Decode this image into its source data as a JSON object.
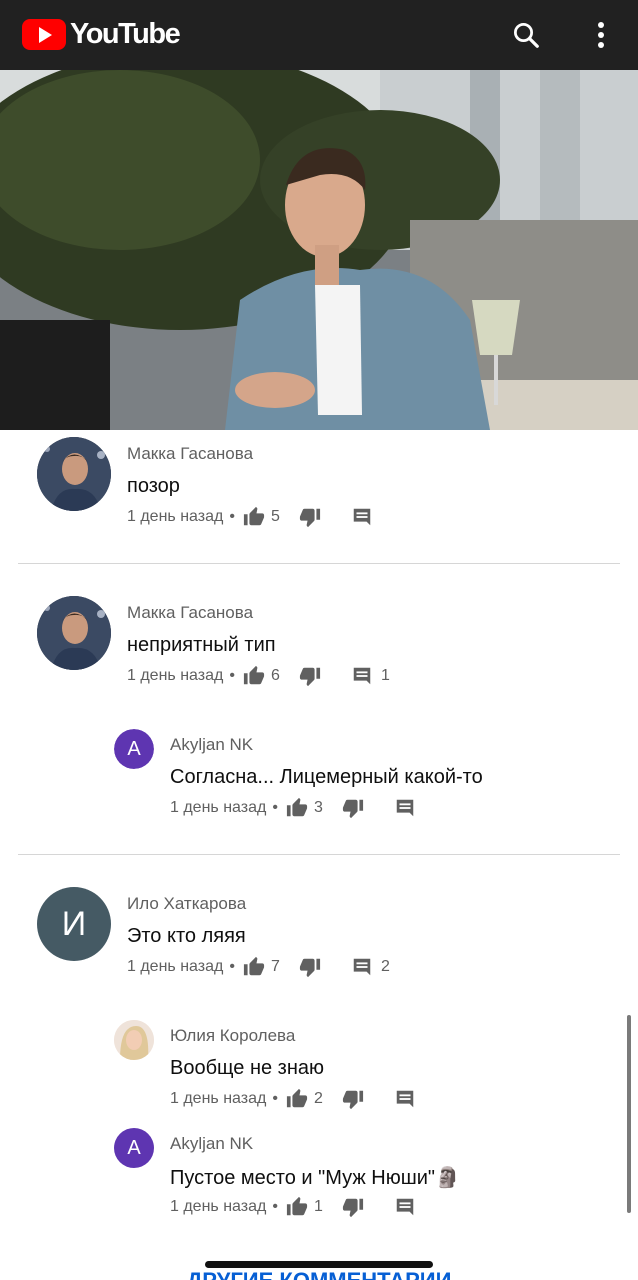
{
  "app": {
    "logo_text": "YouTube",
    "brand_color": "#ff0000",
    "header_bg": "#212121",
    "icons": [
      "search-icon",
      "more-vert-icon"
    ]
  },
  "comments": [
    {
      "author": "Макка Гасанова",
      "text": "позор",
      "time": "1 день назад",
      "likes": "5",
      "replies": "",
      "avatar": "photo",
      "replies_list": []
    },
    {
      "author": "Макка Гасанова",
      "text": "неприятный тип",
      "time": "1 день назад",
      "likes": "6",
      "replies": "1",
      "avatar": "photo",
      "replies_list": [
        {
          "author": "Akyljan NK",
          "text": "Согласна... Лицемерный какой-то",
          "time": "1 день назад",
          "likes": "3",
          "avatar_letter": "A",
          "avatar_color": "#5e35b1"
        }
      ]
    },
    {
      "author": "Ило Хаткарова",
      "text": "Это кто ляяя",
      "time": "1 день назад",
      "likes": "7",
      "replies": "2",
      "avatar_letter": "И",
      "avatar_color": "#455a64",
      "replies_list": [
        {
          "author": "Юлия Королева",
          "text": "Вообще не знаю",
          "time": "1 день назад",
          "likes": "2",
          "avatar": "photo"
        },
        {
          "author": "Akyljan NK",
          "text": "Пустое место и \"Муж Нюши\"",
          "emoji": "🗿",
          "time": "1 день назад",
          "likes": "1",
          "avatar_letter": "A",
          "avatar_color": "#5e35b1"
        }
      ]
    }
  ],
  "more_comments_label": "ДРУГИЕ КОММЕНТАРИИ"
}
